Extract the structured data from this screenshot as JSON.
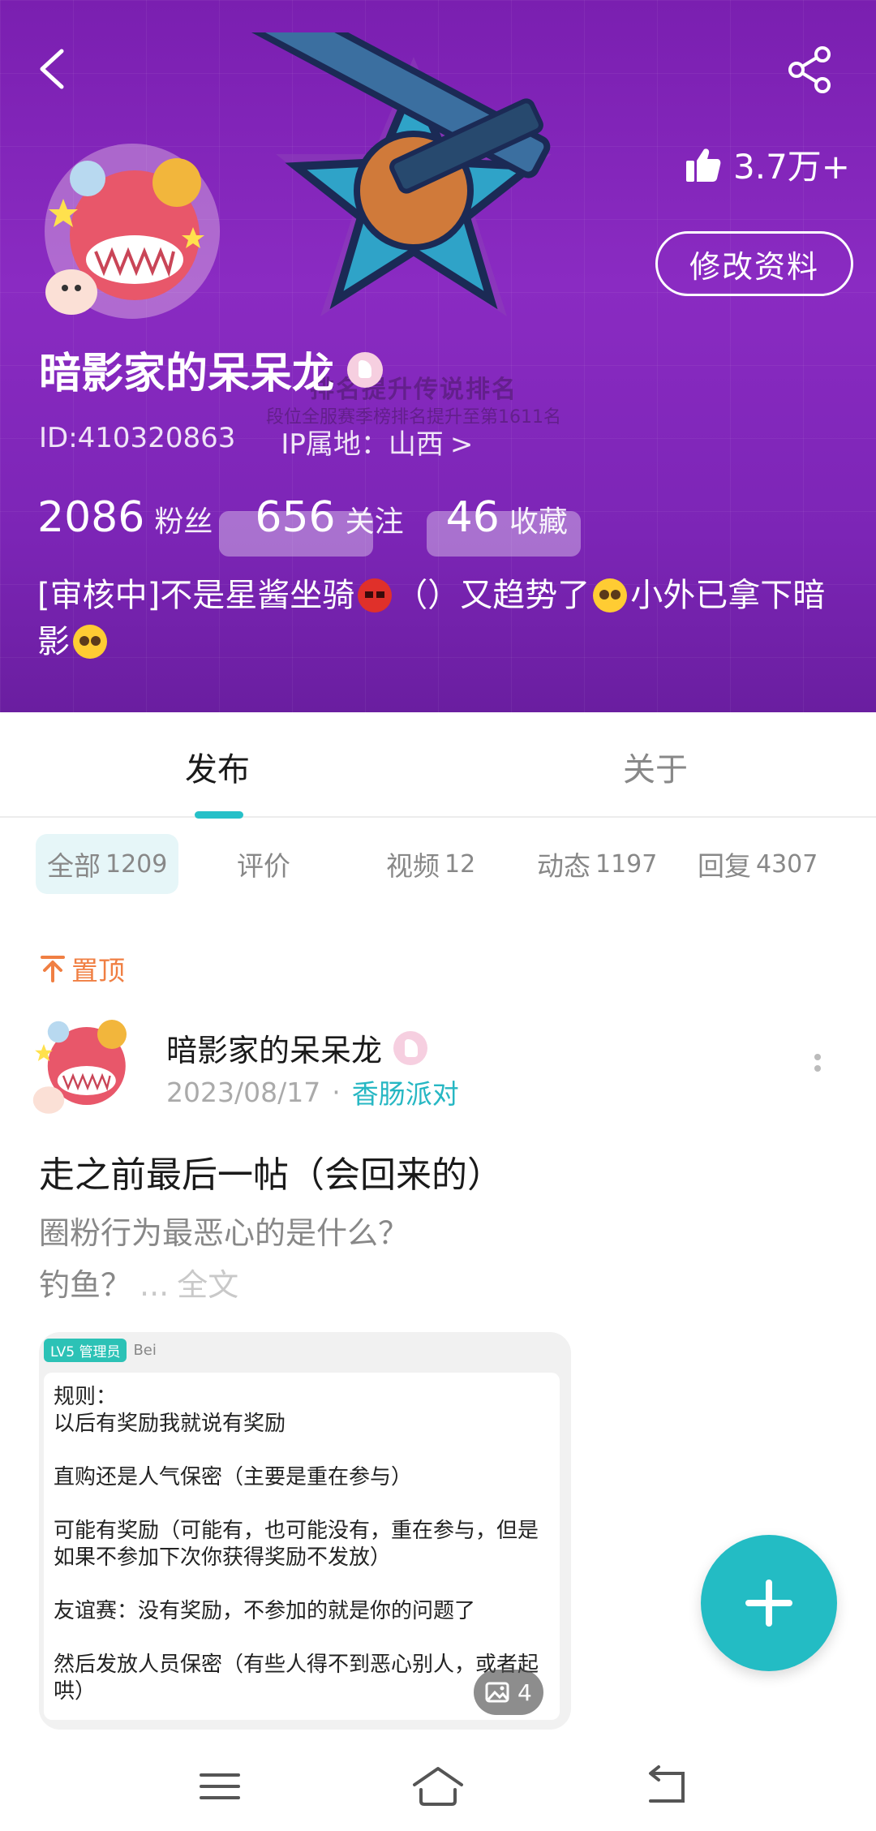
{
  "header": {
    "likes": "3.7万+",
    "edit_profile_label": "修改资料",
    "banner_text_line1": "排名提升传说排名",
    "banner_text_line2": "段位全服赛季榜排名提升至第1611名",
    "banner_button_left": "返回",
    "banner_button_right": "分享"
  },
  "profile": {
    "username": "暗影家的呆呆龙",
    "id_text": "ID:410320863",
    "ip_text": "IP属地：山西",
    "ip_chevron": ">",
    "stats": [
      {
        "value": "2086",
        "label": "粉丝"
      },
      {
        "value": "656",
        "label": "关注"
      },
      {
        "value": "46",
        "label": "收藏"
      }
    ],
    "bio_part1": "[审核中]不是星酱坐骑",
    "bio_part2": "（）又趋势了",
    "bio_part3": "小外已拿下暗影"
  },
  "tabs": {
    "main": [
      {
        "label": "发布"
      },
      {
        "label": "关于"
      }
    ],
    "sub": [
      {
        "label": "全部",
        "count": "1209"
      },
      {
        "label": "评价",
        "count": ""
      },
      {
        "label": "视频",
        "count": "12"
      },
      {
        "label": "动态",
        "count": "1197"
      },
      {
        "label": "回复",
        "count": "4307"
      }
    ]
  },
  "post": {
    "pinned_label": "置顶",
    "author": "暗影家的呆呆龙",
    "date": "2023/08/17",
    "dot": "·",
    "circle": "香肠派对",
    "title": "走之前最后一帖（会回来的）",
    "excerpt_line1": "圈粉行为最恶心的是什么？",
    "excerpt_line2": "钓鱼？",
    "ellipsis": "...",
    "full_text_link": "全文",
    "image": {
      "admin_tag": "LV5 管理员",
      "admin_name": "Bei",
      "content": "规则：\n以后有奖励我就说有奖励\n\n直购还是人气保密（主要是重在参与）\n\n可能有奖励（可能有，也可能没有，重在参与，但是如果不参加下次你获得奖励不发放）\n\n友谊赛：没有奖励，不参加的就是你的问题了\n\n然后发放人员保密（有些人得不到恶心别人，或者起哄）",
      "count": "4"
    }
  },
  "colors": {
    "banner": "#8a2bc2",
    "accent": "#23bcc4",
    "pinned": "#f07f43"
  },
  "icons": [
    "back-icon",
    "share-icon",
    "thumbs-up-icon",
    "pin-icon",
    "more-icon",
    "image-icon",
    "plus-icon",
    "menu-icon",
    "home-icon",
    "return-icon"
  ]
}
